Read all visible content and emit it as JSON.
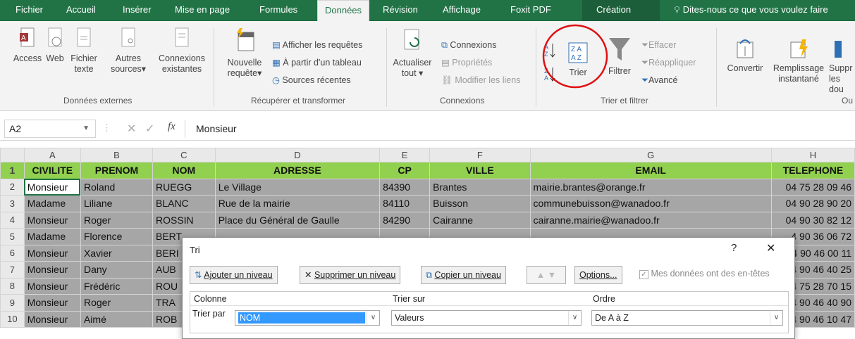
{
  "menu": {
    "tabs": [
      "Fichier",
      "Accueil",
      "Insérer",
      "Mise en page",
      "Formules",
      "Données",
      "Révision",
      "Affichage",
      "Foxit PDF",
      "Création"
    ],
    "tell_me": "Dites-nous ce que vous voulez faire"
  },
  "ribbon": {
    "ext_data": {
      "access": "Access",
      "web": "Web",
      "file_1": "Fichier",
      "file_2": "texte",
      "other_1": "Autres",
      "other_2": "sources",
      "conn_1": "Connexions",
      "conn_2": "existantes",
      "group": "Données externes"
    },
    "get_transform": {
      "show_queries": "Afficher les requêtes",
      "from_table": "À partir d'un tableau",
      "new_query_1": "Nouvelle",
      "new_query_2": "requête",
      "recent": "Sources récentes",
      "group": "Récupérer et transformer"
    },
    "connections": {
      "refresh_1": "Actualiser",
      "refresh_2": "tout",
      "connections": "Connexions",
      "properties": "Propriétés",
      "edit_links": "Modifier les liens",
      "group": "Connexions"
    },
    "sort_filter": {
      "sort": "Trier",
      "filter": "Filtrer",
      "clear": "Effacer",
      "reapply": "Réappliquer",
      "advanced": "Avancé",
      "group": "Trier et filtrer"
    },
    "data_tools": {
      "convert": "Convertir",
      "flash_1": "Remplissage",
      "flash_2": "instantané",
      "remove_1": "Suppr",
      "remove_2": "les dou",
      "group": "Ou"
    }
  },
  "formula_bar": {
    "cell_ref": "A2",
    "fx": "fx",
    "value": "Monsieur"
  },
  "sheet": {
    "columns": [
      "A",
      "B",
      "C",
      "D",
      "E",
      "F",
      "G",
      "H"
    ],
    "header": [
      "CIVILITE",
      "PRENOM",
      "NOM",
      "ADRESSE",
      "CP",
      "VILLE",
      "EMAIL",
      "TELEPHONE"
    ],
    "rows": [
      {
        "n": "2",
        "civ": "Monsieur",
        "prenom": "Roland",
        "nom": "RUEGG",
        "adresse": "Le Village",
        "cp": "84390",
        "ville": "Brantes",
        "email": "mairie.brantes@orange.fr",
        "tel": "04 75 28 09 46"
      },
      {
        "n": "3",
        "civ": "Madame",
        "prenom": "Liliane",
        "nom": "BLANC",
        "adresse": "Rue de la mairie",
        "cp": "84110",
        "ville": "Buisson",
        "email": "communebuisson@wanadoo.fr",
        "tel": "04 90 28 90 20"
      },
      {
        "n": "4",
        "civ": "Monsieur",
        "prenom": "Roger",
        "nom": "ROSSIN",
        "adresse": "Place du Général de Gaulle",
        "cp": "84290",
        "ville": "Cairanne",
        "email": "cairanne.mairie@wanadoo.fr",
        "tel": "04 90 30 82 12"
      },
      {
        "n": "5",
        "civ": "Madame",
        "prenom": "Florence",
        "nom": "BERT",
        "adresse": "",
        "cp": "",
        "ville": "",
        "email": "",
        "tel": "4 90 36 06 72"
      },
      {
        "n": "6",
        "civ": "Monsieur",
        "prenom": "Xavier",
        "nom": "BERI",
        "adresse": "",
        "cp": "",
        "ville": "",
        "email": "",
        "tel": "4 90 46 00 11"
      },
      {
        "n": "7",
        "civ": "Monsieur",
        "prenom": "Dany",
        "nom": "AUB",
        "adresse": "",
        "cp": "",
        "ville": "",
        "email": "",
        "tel": "4 90 46 40 25"
      },
      {
        "n": "8",
        "civ": "Monsieur",
        "prenom": "Frédéric",
        "nom": "ROU",
        "adresse": "",
        "cp": "",
        "ville": "",
        "email": "",
        "tel": "4 75 28 70 15"
      },
      {
        "n": "9",
        "civ": "Monsieur",
        "prenom": "Roger",
        "nom": "TRA",
        "adresse": "",
        "cp": "",
        "ville": "",
        "email": "",
        "tel": "4 90 46 40 90"
      },
      {
        "n": "10",
        "civ": "Monsieur",
        "prenom": "Aimé",
        "nom": "ROB",
        "adresse": "",
        "cp": "",
        "ville": "",
        "email": "",
        "tel": "4 90 46 10 47"
      }
    ]
  },
  "dialog": {
    "title": "Tri",
    "help": "?",
    "close": "✕",
    "add_level": "Ajouter un niveau",
    "delete_level": "Supprimer un niveau",
    "copy_level": "Copier un niveau",
    "options": "Options...",
    "headers_check": "Mes données ont des en-têtes",
    "col_header": "Colonne",
    "sort_on_header": "Trier sur",
    "order_header": "Ordre",
    "sort_by": "Trier par",
    "sort_by_value": "NOM",
    "sort_on_value": "Valeurs",
    "order_value": "De A à Z"
  },
  "colors": {
    "brand": "#217346",
    "header_fill": "#92d050",
    "selection": "#a6a6a6",
    "annotation": "#e01010"
  }
}
